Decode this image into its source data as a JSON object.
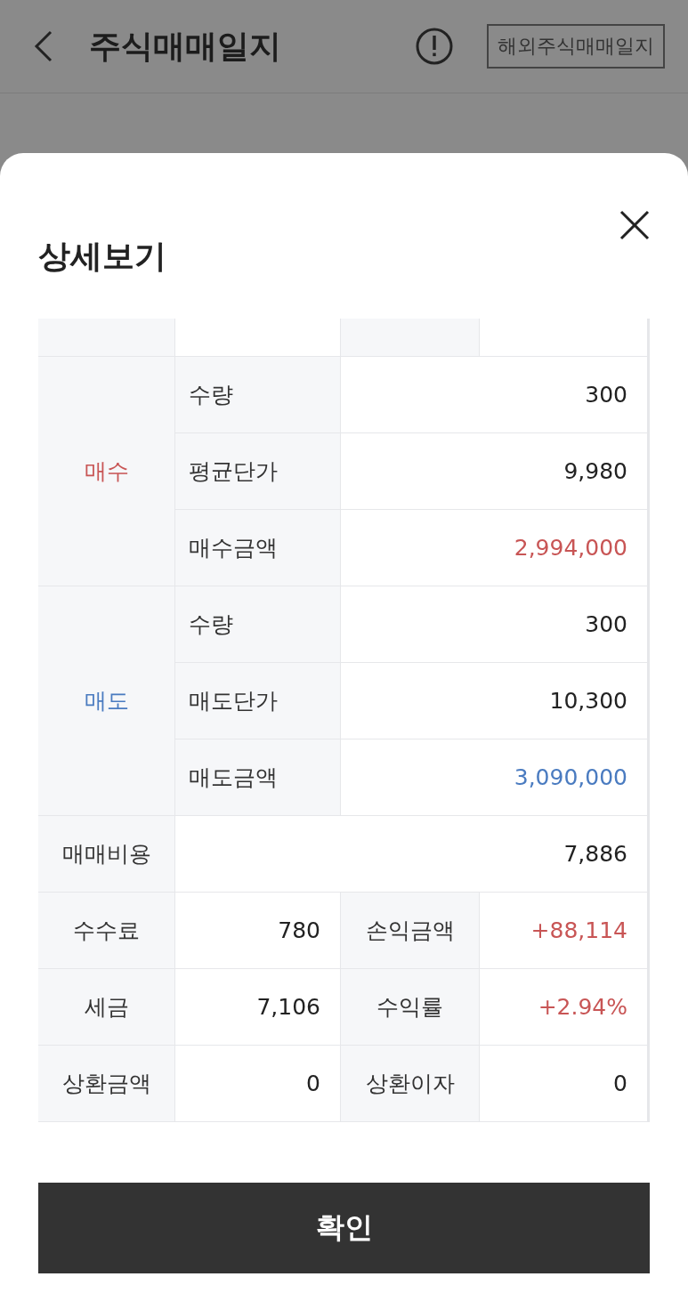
{
  "header": {
    "title": "주식매매일지",
    "overseas_button": "해외주식매매일지"
  },
  "sheet": {
    "title": "상세보기",
    "groups": [
      {
        "label": "매수",
        "color": "#c85555",
        "rows": [
          {
            "label": "수량",
            "value": "300"
          },
          {
            "label": "평균단가",
            "value": "9,980"
          },
          {
            "label": "매수금액",
            "value": "2,994,000",
            "color": "#c85555"
          }
        ]
      },
      {
        "label": "매도",
        "color": "#4a7bc0",
        "rows": [
          {
            "label": "수량",
            "value": "300"
          },
          {
            "label": "매도단가",
            "value": "10,300"
          },
          {
            "label": "매도금액",
            "value": "3,090,000",
            "color": "#4a7bc0"
          }
        ]
      }
    ],
    "cost": {
      "label": "매매비용",
      "value": "7,886"
    },
    "pairs": [
      [
        {
          "label": "수수료",
          "value": "780"
        },
        {
          "label": "손익금액",
          "value": "+88,114",
          "color": "#c85555"
        }
      ],
      [
        {
          "label": "세금",
          "value": "7,106"
        },
        {
          "label": "수익률",
          "value": "+2.94%",
          "color": "#c85555"
        }
      ],
      [
        {
          "label": "상환금액",
          "value": "0"
        },
        {
          "label": "상환이자",
          "value": "0"
        }
      ]
    ],
    "confirm_button": "확인"
  }
}
